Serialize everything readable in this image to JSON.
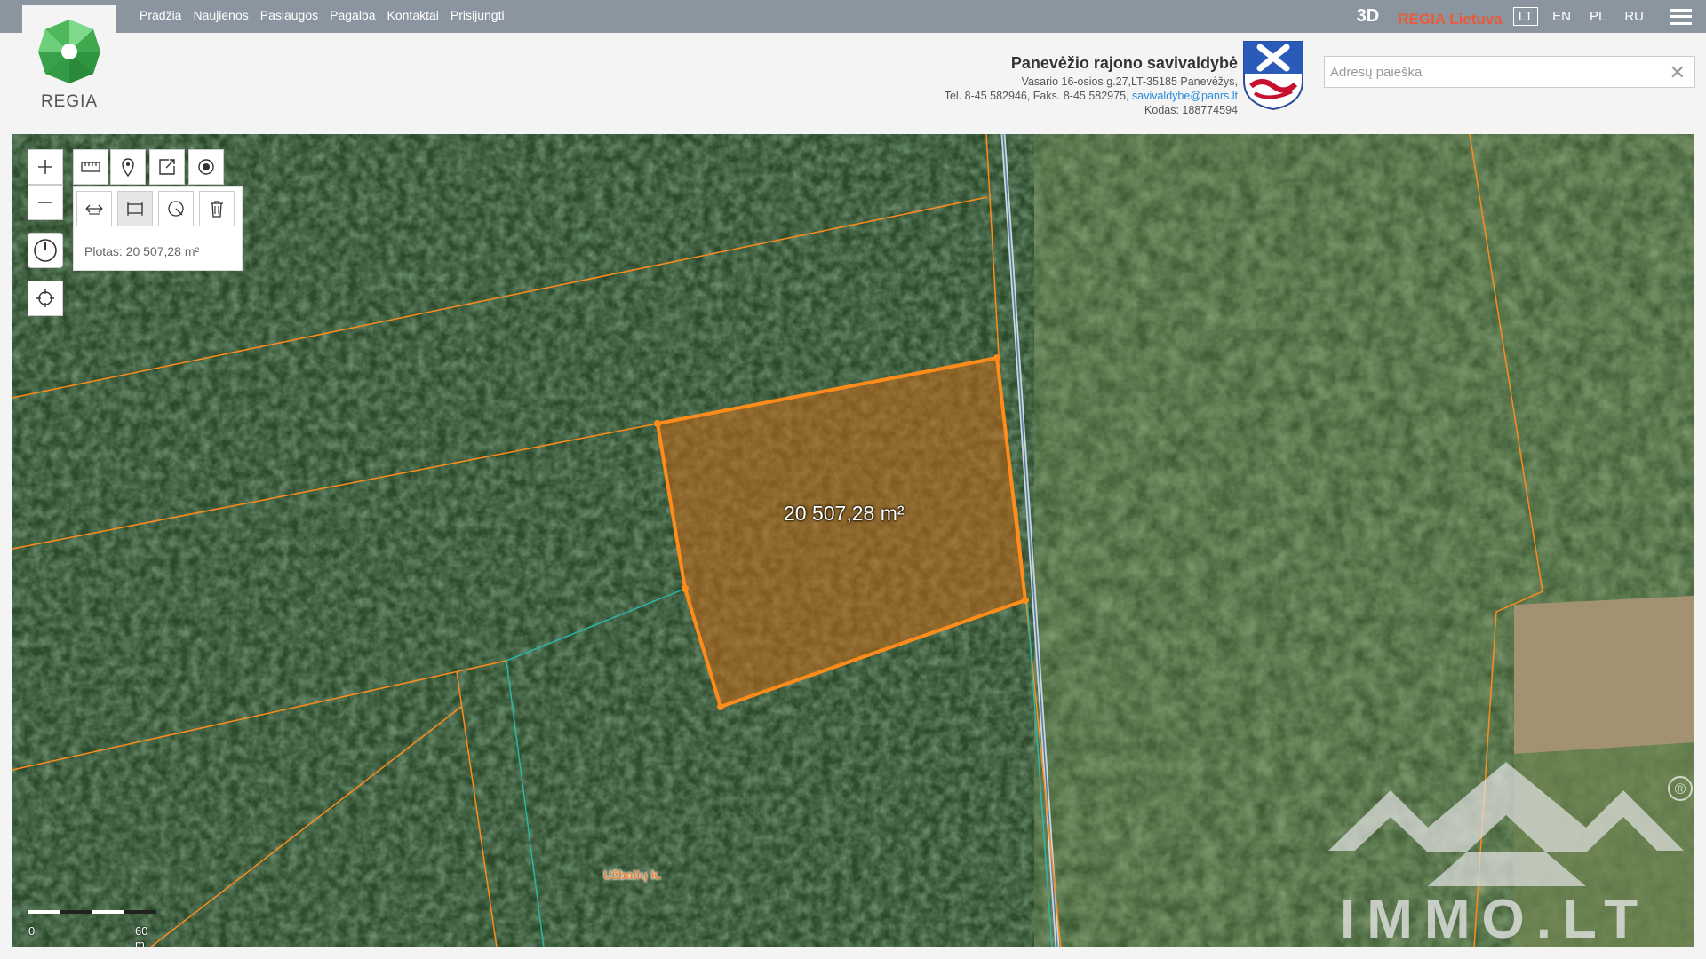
{
  "header": {
    "logo_text": "REGIA",
    "nav": [
      "Pradžia",
      "Naujienos",
      "Paslaugos",
      "Pagalba",
      "Kontaktai",
      "Prisijungti"
    ],
    "btn_3d": "3D",
    "regia_region": "REGIA Lietuva",
    "languages": [
      "LT",
      "EN",
      "PL",
      "RU"
    ],
    "active_language": "LT"
  },
  "municipality": {
    "name": "Panevėžio rajono savivaldybė",
    "address": "Vasario 16-osios g.27,LT-35185 Panevėžys,",
    "phone_fax": "Tel. 8-45 582946, Faks. 8-45 582975,",
    "email": "savivaldybe@panrs.lt",
    "code": "Kodas: 188774594"
  },
  "search": {
    "placeholder": "Adresų paieška",
    "clear": "✕"
  },
  "map": {
    "measure_readout": "Plotas: 20 507,28 m²",
    "area_label": "20 507,28 m²",
    "place_label": "Užbalių k.",
    "scale": {
      "start": "0",
      "end": "60 m"
    }
  },
  "watermark": {
    "text": "IMMO.LT",
    "registered": "®"
  },
  "colors": {
    "topbar": "#8b959f",
    "parcel_orange": "#ff8c1a",
    "accent_red": "#e85a3c",
    "link": "#2a8bd9"
  }
}
